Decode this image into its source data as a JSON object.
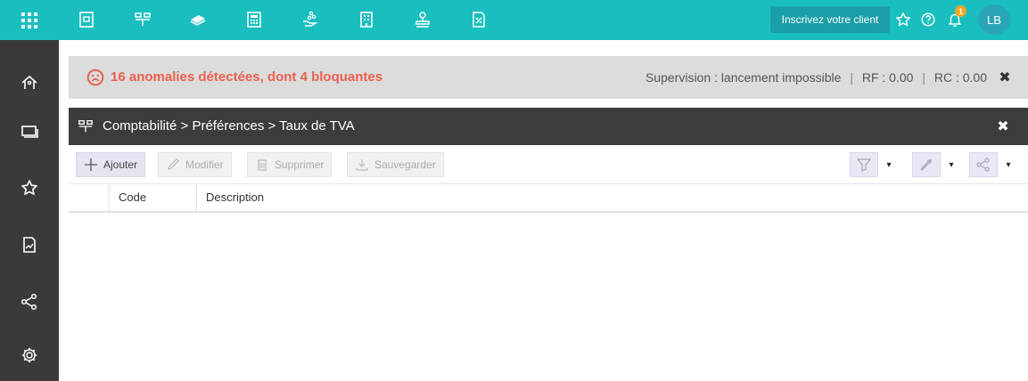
{
  "topbar": {
    "cta_label": "Inscrivez votre client",
    "notification_count": "1",
    "avatar_initials": "LB",
    "accent_color": "#19bfbf",
    "icons": [
      "apps-grid-icon",
      "document-icon",
      "org-chart-icon",
      "money-stack-icon",
      "calculator-icon",
      "hand-coins-icon",
      "building-icon",
      "stamp-icon",
      "percent-doc-icon",
      "star-icon",
      "help-icon",
      "bell-icon"
    ]
  },
  "sidebar": {
    "icons": [
      "home-icon",
      "windows-icon",
      "star-icon",
      "chart-doc-icon",
      "share-icon",
      "settings-icon"
    ]
  },
  "alert": {
    "message": "16 anomalies détectées, dont 4 bloquantes",
    "supervision_label": "Supervision :",
    "supervision_value": "lancement impossible",
    "rf": "RF : 0.00",
    "rc": "RC : 0.00",
    "separator": "|",
    "close_symbol": "✖"
  },
  "panel": {
    "breadcrumb": "Comptabilité > Préférences > Taux de TVA",
    "close_symbol": "✖"
  },
  "toolbar": {
    "add_label": "Ajouter",
    "edit_label": "Modifier",
    "delete_label": "Supprimer",
    "save_label": "Sauvegarder",
    "caret": "▾"
  },
  "table": {
    "columns": [
      "Code",
      "Description"
    ],
    "rows": []
  }
}
